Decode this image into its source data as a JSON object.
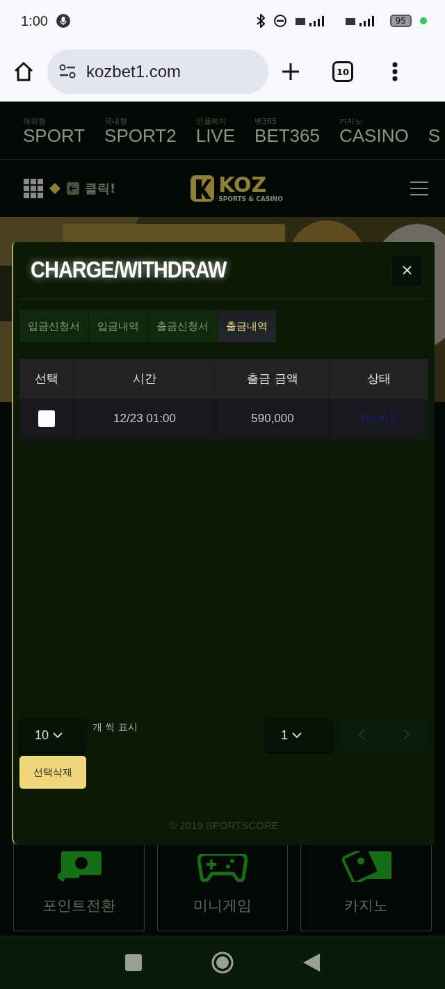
{
  "status_bar": {
    "time": "1:00",
    "battery": "95"
  },
  "browser": {
    "url": "kozbet1.com",
    "tab_count": "10"
  },
  "nav": [
    {
      "sub": "해외형",
      "label": "SPORT"
    },
    {
      "sub": "국내형",
      "label": "SPORT2"
    },
    {
      "sub": "인플레이",
      "label": "LIVE"
    },
    {
      "sub": "벳365",
      "label": "BET365"
    },
    {
      "sub": "카지노",
      "label": "CASINO"
    },
    {
      "label": "S"
    }
  ],
  "header": {
    "click_label": "클릭!",
    "logo": "KOZ",
    "logo_sub": "SPORTS & CASINO"
  },
  "tiles": [
    {
      "kind": "exchange",
      "label": "포인트전환"
    },
    {
      "kind": "game",
      "label": "미니게임"
    },
    {
      "kind": "cards",
      "label": "카지노"
    }
  ],
  "modal": {
    "title": "CHARGE/WITHDRAW",
    "tabs": [
      {
        "label": "입금신청서",
        "selected": false
      },
      {
        "label": "입금내역",
        "selected": false
      },
      {
        "label": "출금신청서",
        "selected": false
      },
      {
        "label": "출금내역",
        "selected": true
      }
    ],
    "columns": [
      "선택",
      "시간",
      "출금 금액",
      "상태"
    ],
    "rows": [
      {
        "checked": false,
        "time": "12/23 01:00",
        "amount": "590,000",
        "status": "취소하기"
      }
    ],
    "page_size": "10",
    "page_size_label": "개 씩 표시",
    "page": "1",
    "delete_button": "선택삭제",
    "footer": "© 2019 SPORTSCORE"
  }
}
